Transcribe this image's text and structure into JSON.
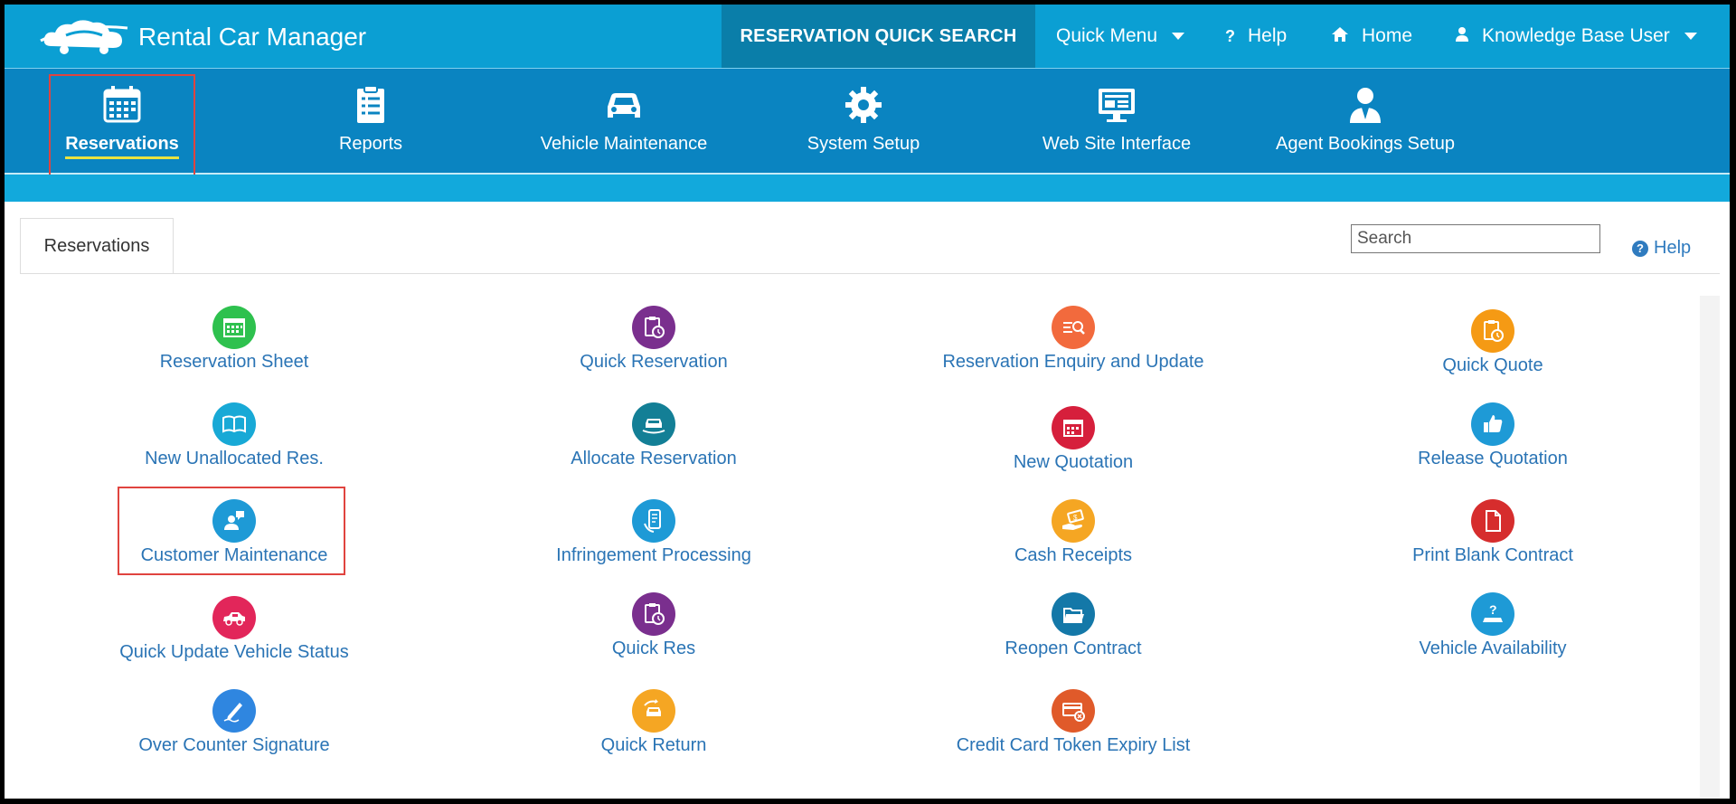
{
  "app": {
    "title": "Rental Car Manager"
  },
  "topbar": {
    "quick_search": "RESERVATION QUICK SEARCH",
    "quick_menu": "Quick Menu",
    "help": "Help",
    "home": "Home",
    "user": "Knowledge Base User"
  },
  "modules": [
    {
      "label": "Reservations",
      "icon": "calendar-icon",
      "active": true
    },
    {
      "label": "Reports",
      "icon": "clipboard-icon"
    },
    {
      "label": "Vehicle Maintenance",
      "icon": "car-icon"
    },
    {
      "label": "System Setup",
      "icon": "gear-icon"
    },
    {
      "label": "Web Site Interface",
      "icon": "monitor-icon"
    },
    {
      "label": "Agent Bookings Setup",
      "icon": "agent-icon"
    }
  ],
  "tab": {
    "label": "Reservations"
  },
  "search": {
    "placeholder": "Search"
  },
  "help_link": {
    "label": "Help"
  },
  "items": [
    {
      "label": "Reservation Sheet",
      "color": "#2ec14e",
      "icon": "calendar-grid-icon"
    },
    {
      "label": "Quick Reservation",
      "color": "#7a2f8e",
      "icon": "clipboard-timer-icon"
    },
    {
      "label": "Reservation Enquiry and Update",
      "color": "#f26a3d",
      "icon": "list-search-icon"
    },
    {
      "label": "Quick Quote",
      "color": "#f59a14",
      "icon": "clipboard-timer-icon"
    },
    {
      "label": "New Unallocated Res.",
      "color": "#18a9d6",
      "icon": "book-icon"
    },
    {
      "label": "Allocate Reservation",
      "color": "#137f96",
      "icon": "car-hand-icon"
    },
    {
      "label": "New Quotation",
      "color": "#d61f3c",
      "icon": "calendar-icon"
    },
    {
      "label": "Release Quotation",
      "color": "#1e9ad6",
      "icon": "thumbs-up-icon"
    },
    {
      "label": "Customer Maintenance",
      "color": "#1e9ad6",
      "icon": "user-chat-icon"
    },
    {
      "label": "Infringement Processing",
      "color": "#1e9ad6",
      "icon": "phone-document-icon"
    },
    {
      "label": "Cash Receipts",
      "color": "#f5a623",
      "icon": "hand-cash-icon"
    },
    {
      "label": "Print Blank Contract",
      "color": "#d62d2d",
      "icon": "document-icon"
    },
    {
      "label": "Quick Update Vehicle Status",
      "color": "#e2265a",
      "icon": "car-icon"
    },
    {
      "label": "Quick Res",
      "color": "#7a2f8e",
      "icon": "clipboard-timer-icon"
    },
    {
      "label": "Reopen Contract",
      "color": "#1478a8",
      "icon": "folder-open-icon"
    },
    {
      "label": "Vehicle Availability",
      "color": "#1e9ad6",
      "icon": "question-car-icon"
    },
    {
      "label": "Over Counter Signature",
      "color": "#2f86e0",
      "icon": "pen-signature-icon"
    },
    {
      "label": "Quick Return",
      "color": "#f5a623",
      "icon": "car-return-icon"
    },
    {
      "label": "Credit Card Token Expiry List",
      "color": "#e05a2a",
      "icon": "card-cancel-icon"
    }
  ]
}
